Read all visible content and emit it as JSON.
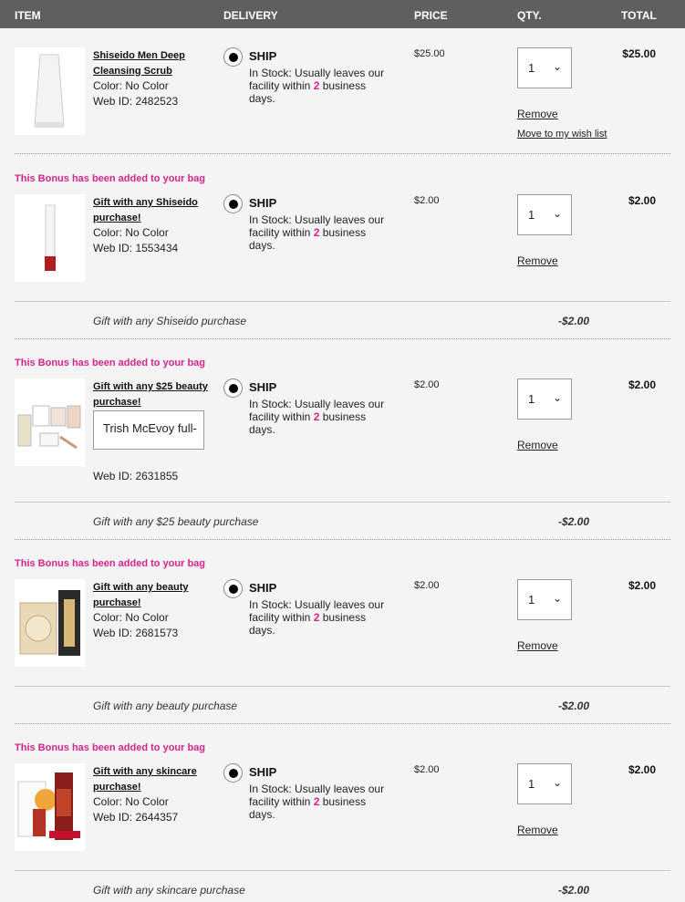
{
  "header": {
    "item": "ITEM",
    "delivery": "DELIVERY",
    "price": "PRICE",
    "qty": "QTY.",
    "total": "TOTAL"
  },
  "common": {
    "ship": "SHIP",
    "stock_prefix": "In Stock: Usually leaves our facility within ",
    "stock_days": "2",
    "stock_suffix": " business days.",
    "remove": "Remove",
    "wish": "Move to my wish list",
    "bonus_note": "This Bonus has been added to your bag"
  },
  "items": [
    {
      "name": "Shiseido Men Deep Cleansing Scrub",
      "color": "Color: No Color",
      "web_id": "Web ID: 2482523",
      "price": "$25.00",
      "qty": "1",
      "total": "$25.00"
    },
    {
      "name": "Gift with any Shiseido purchase!",
      "color": "Color: No Color",
      "web_id": "Web ID: 1553434",
      "price": "$2.00",
      "qty": "1",
      "total": "$2.00",
      "discount_label": "Gift with any Shiseido purchase",
      "discount": "-$2.00"
    },
    {
      "name": "Gift with any $25 beauty purchase!",
      "select_value": "Trish McEvoy full-",
      "web_id": "Web ID: 2631855",
      "price": "$2.00",
      "qty": "1",
      "total": "$2.00",
      "discount_label": "Gift with any $25 beauty purchase",
      "discount": "-$2.00"
    },
    {
      "name": "Gift with any beauty purchase!",
      "color": "Color: No Color",
      "web_id": "Web ID: 2681573",
      "price": "$2.00",
      "qty": "1",
      "total": "$2.00",
      "discount_label": "Gift with any beauty purchase",
      "discount": "-$2.00"
    },
    {
      "name": "Gift with any skincare purchase!",
      "color": "Color: No Color",
      "web_id": "Web ID: 2644357",
      "price": "$2.00",
      "qty": "1",
      "total": "$2.00",
      "discount_label": "Gift with any skincare purchase",
      "discount": "-$2.00"
    }
  ],
  "icons": {
    "radio": "radio-selected-icon",
    "chevron": "chevron-down-icon"
  },
  "colors": {
    "header_bg": "#5f5f5f",
    "accent": "#d6248f",
    "page_bg": "#f4f4f4"
  }
}
